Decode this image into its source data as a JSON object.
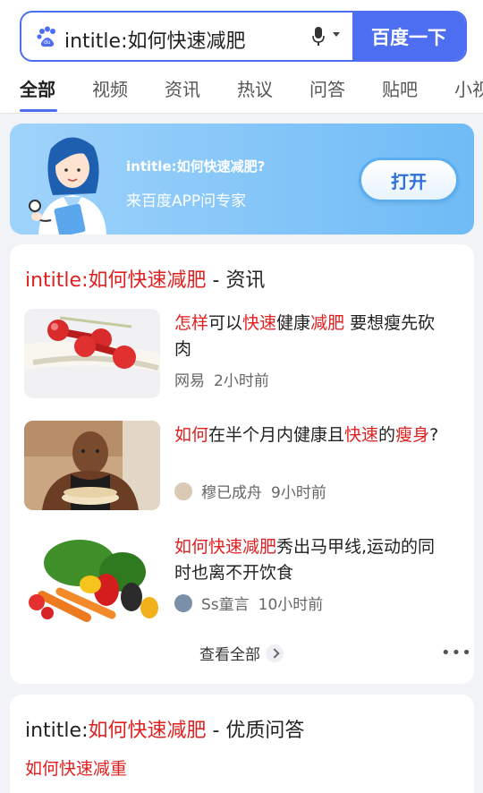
{
  "search": {
    "query": "intitle:如何快速减肥",
    "button_label": "百度一下"
  },
  "tabs": [
    {
      "label": "全部",
      "active": true
    },
    {
      "label": "视频"
    },
    {
      "label": "资讯"
    },
    {
      "label": "热议"
    },
    {
      "label": "问答"
    },
    {
      "label": "贴吧"
    },
    {
      "label": "小视"
    }
  ],
  "banner": {
    "question": "intitle:如何快速减肥?",
    "subtitle": "来百度APP问专家",
    "open_label": "打开"
  },
  "news_card": {
    "title_query": "intitle:如何快速减肥",
    "title_suffix": " - 资讯",
    "items": [
      {
        "title_parts": [
          {
            "text": "怎样",
            "hl": true
          },
          {
            "text": "可以",
            "hl": false
          },
          {
            "text": "快速",
            "hl": true
          },
          {
            "text": "健康",
            "hl": false
          },
          {
            "text": "减肥",
            "hl": true
          },
          {
            "text": " 要想瘦先砍肉",
            "hl": false
          }
        ],
        "source": "网易",
        "time": "2小时前",
        "thumb": "dumbbells-image"
      },
      {
        "title_parts": [
          {
            "text": "如何",
            "hl": true
          },
          {
            "text": "在半个月内健康且",
            "hl": false
          },
          {
            "text": "快速",
            "hl": true
          },
          {
            "text": "的",
            "hl": false
          },
          {
            "text": "瘦身",
            "hl": true
          },
          {
            "text": "?",
            "hl": false
          }
        ],
        "source": "穆已成舟",
        "time": "9小时前",
        "thumb": "man-eating-image"
      },
      {
        "title_parts": [
          {
            "text": "如何快速减肥",
            "hl": true
          },
          {
            "text": "秀出马甲线,运动的同时也离不开饮食",
            "hl": false
          }
        ],
        "source": "Ss童言",
        "time": "10小时前",
        "thumb": "vegetables-image"
      }
    ],
    "more_label": "查看全部",
    "dots": "•••"
  },
  "qa_card": {
    "title_prefix": "intitle:",
    "title_query": "如何快速减肥",
    "title_suffix": " - 优质问答",
    "first_question": "如何快速减重"
  },
  "colors": {
    "accent": "#4e6ef2",
    "highlight": "#e02020"
  }
}
